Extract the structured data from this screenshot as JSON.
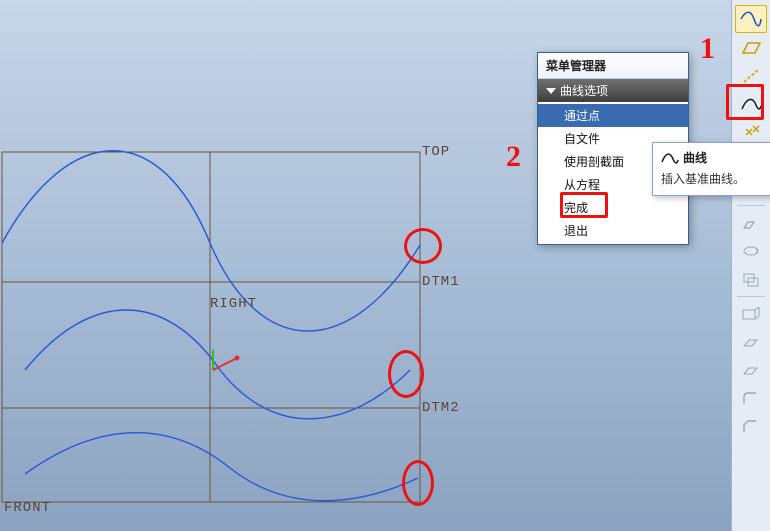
{
  "planes": {
    "top": "TOP",
    "right": "RIGHT",
    "dtm1": "DTM1",
    "dtm2": "DTM2",
    "front": "FRONT"
  },
  "menu": {
    "title": "菜单管理器",
    "section": "曲线选项",
    "items": [
      {
        "label": "通过点",
        "selected": true
      },
      {
        "label": "自文件",
        "selected": false
      },
      {
        "label": "使用剖截面",
        "selected": false
      },
      {
        "label": "从方程",
        "selected": false
      },
      {
        "label": "完成",
        "selected": false
      },
      {
        "label": "退出",
        "selected": false
      }
    ]
  },
  "tooltip": {
    "head": "曲线",
    "body": "插入基准曲线。"
  },
  "annotations": {
    "one": "1",
    "two": "2"
  },
  "toolbar": {
    "icons": [
      "spline-icon",
      "plane-icon",
      "axis-icon",
      "curve-icon",
      "point-icon",
      "csys-icon",
      "pattern-icon",
      "sep",
      "extrude-icon",
      "revolve-icon",
      "sweep-icon",
      "sep",
      "display1-icon",
      "display2-icon",
      "display3-icon",
      "fillet-icon",
      "chamfer-icon"
    ],
    "curve_highlight_index": 3,
    "spline_active_index": 0
  }
}
